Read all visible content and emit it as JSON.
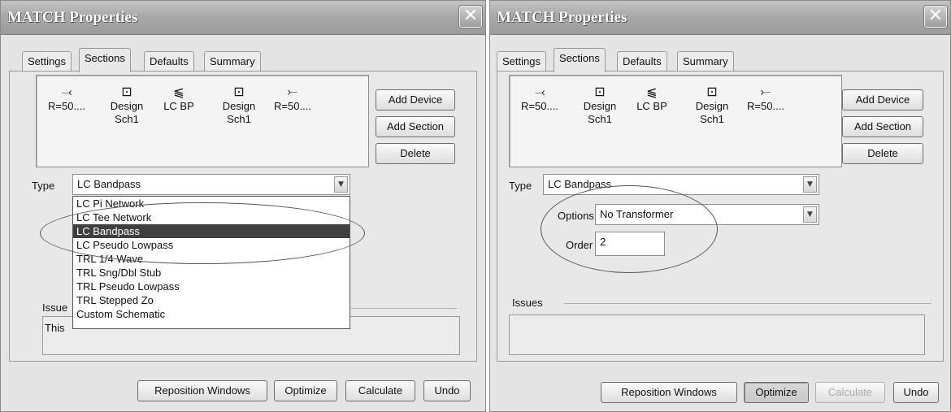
{
  "left": {
    "title": "MATCH Properties",
    "close_glyph": "✕",
    "tabs": [
      "Settings",
      "Sections",
      "Defaults",
      "Summary"
    ],
    "sections": [
      {
        "icon": "source-port-icon",
        "glyph": "⤙",
        "line1": "R=50....",
        "line2": ""
      },
      {
        "icon": "design-block-icon",
        "glyph": "⊡",
        "line1": "Design",
        "line2": "Sch1"
      },
      {
        "icon": "lc-bandpass-icon",
        "glyph": "⫹",
        "line1": "LC BP",
        "line2": ""
      },
      {
        "icon": "design-block-icon",
        "glyph": "⊡",
        "line1": "Design",
        "line2": "Sch1"
      },
      {
        "icon": "load-port-icon",
        "glyph": "⤚",
        "line1": "R=50....",
        "line2": ""
      }
    ],
    "buttons": {
      "add_device": "Add Device",
      "add_section": "Add Section",
      "delete": "Delete"
    },
    "type_label": "Type",
    "type_value": "LC Bandpass",
    "dropdown_options": [
      "LC Pi Network",
      "LC Tee Network",
      "LC Bandpass",
      "LC Pseudo Lowpass",
      "TRL 1/4 Wave",
      "TRL Sng/Dbl Stub",
      "TRL Pseudo Lowpass",
      "TRL Stepped Zo",
      "Custom Schematic"
    ],
    "selected_option": "LC Bandpass",
    "issues_label": "Issue",
    "issues_text": "This",
    "bottom": {
      "reposition": "Reposition Windows",
      "optimize": "Optimize",
      "calculate": "Calculate",
      "undo": "Undo"
    }
  },
  "right": {
    "title": "MATCH Properties",
    "close_glyph": "✕",
    "tabs": [
      "Settings",
      "Sections",
      "Defaults",
      "Summary"
    ],
    "sections": [
      {
        "icon": "source-port-icon",
        "glyph": "⤙",
        "line1": "R=50....",
        "line2": ""
      },
      {
        "icon": "design-block-icon",
        "glyph": "⊡",
        "line1": "Design",
        "line2": "Sch1"
      },
      {
        "icon": "lc-bandpass-icon",
        "glyph": "⫹",
        "line1": "LC BP",
        "line2": ""
      },
      {
        "icon": "design-block-icon",
        "glyph": "⊡",
        "line1": "Design",
        "line2": "Sch1"
      },
      {
        "icon": "load-port-icon",
        "glyph": "⤚",
        "line1": "R=50....",
        "line2": ""
      }
    ],
    "buttons": {
      "add_device": "Add Device",
      "add_section": "Add Section",
      "delete": "Delete"
    },
    "type_label": "Type",
    "type_value": "LC Bandpass",
    "options_label": "Options",
    "options_value": "No Transformer",
    "order_label": "Order",
    "order_value": "2",
    "issues_label": "Issues",
    "bottom": {
      "reposition": "Reposition Windows",
      "optimize": "Optimize",
      "calculate": "Calculate",
      "undo": "Undo"
    }
  }
}
